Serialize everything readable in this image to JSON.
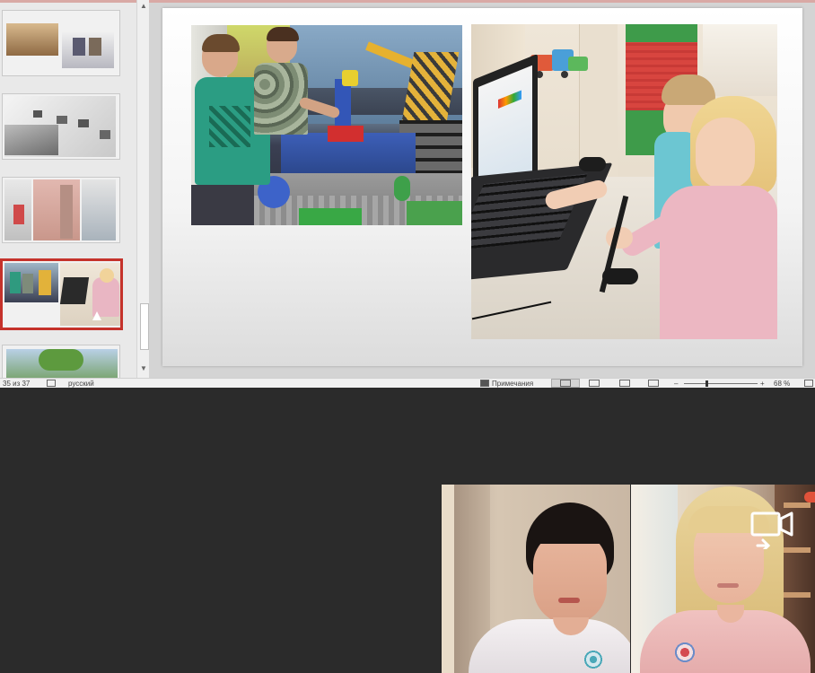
{
  "statusbar": {
    "slide_counter": "35 из 37",
    "language": "русский",
    "notes_label": "Примечания",
    "zoom_level": "68 %"
  },
  "thumbnails": [
    {
      "index": 1,
      "selected": false
    },
    {
      "index": 2,
      "selected": false
    },
    {
      "index": 3,
      "selected": false
    },
    {
      "index": 4,
      "selected": true
    },
    {
      "index": 5,
      "selected": false
    }
  ],
  "slide": {
    "photos": [
      {
        "name": "lego-construction-photo"
      },
      {
        "name": "kids-laptop-photo"
      }
    ]
  },
  "video_call": {
    "participants": [
      {
        "name": "participant-left"
      },
      {
        "name": "participant-right"
      }
    ],
    "icons": [
      "screen-share-icon",
      "recording-indicator"
    ]
  },
  "colors": {
    "selected_thumbnail_border": "#c5322b",
    "dark_background": "#2b2b2b",
    "accent_top": "#d9a9a5"
  }
}
